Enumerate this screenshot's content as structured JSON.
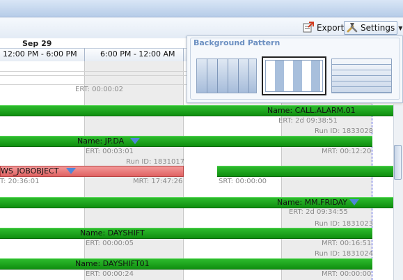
{
  "toolbar": {
    "export_label": "Export",
    "settings_label": "Settings"
  },
  "timeline": {
    "date": "Sep 29",
    "columns": [
      "12:00 PM - 6:00 PM",
      "6:00 PM - 12:00 AM"
    ]
  },
  "rows": {
    "r0": {
      "ert": "ERT: 00:00:02"
    },
    "r1": {
      "name": "Name: CALL.ALARM.01",
      "ert": "ERT: 2d 09:38:51",
      "run_id": "Run ID: 1833028"
    },
    "r2": {
      "name": "Name: JP.DA",
      "ert": "ERT: 00:03:01",
      "mrt": "MRT: 00:12:20",
      "run_id": "Run ID: 1831017"
    },
    "r3": {
      "name": "WS_JOBOBJECT",
      "ert": "T: 20:36:01",
      "mrt": "MRT: 17:47:26",
      "srt": "SRT: 00:00:00"
    },
    "r4": {
      "name": "Name: MM.FRIDAY",
      "ert": "ERT: 2d 09:34:55",
      "run_id": "Run ID: 1831023"
    },
    "r5": {
      "name": "Name: DAYSHIFT",
      "ert": "ERT: 00:00:05",
      "mrt": "MRT: 00:16:51",
      "run_id": "Run ID: 1831024"
    },
    "r6": {
      "name": "Name: DAYSHIFT01",
      "ert": "ERT: 00:00:24",
      "mrt": "MRT: 00:00:00"
    }
  },
  "popup": {
    "title": "Background Pattern",
    "patterns": [
      "vertical-lines-pattern",
      "vertical-bands-pattern",
      "horizontal-lines-pattern"
    ],
    "selected_index": 1
  },
  "colors": {
    "job_bar": "#1ea51e",
    "failed_bar": "#e87070",
    "current_time_line": "#2a35d8",
    "popup_title": "#6b8fc1"
  },
  "icons": {
    "export": "export-icon",
    "settings": "tools-icon",
    "expand": "expand-triangle-icon"
  }
}
